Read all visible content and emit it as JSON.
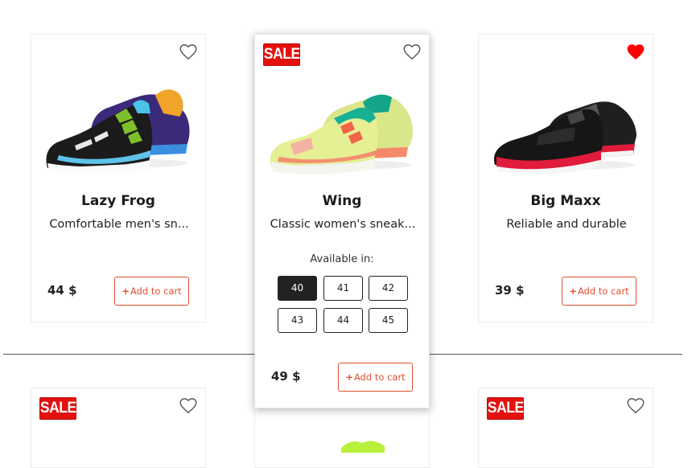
{
  "products": [
    {
      "name": "Lazy Frog",
      "description": "Comfortable men's sn...",
      "price": "44 $",
      "add_to_cart": "Add to cart",
      "favorite": false,
      "sale": false
    },
    {
      "name": "Wing",
      "description": "Classic women's sneak...",
      "price": "49 $",
      "add_to_cart": "Add to cart",
      "favorite": false,
      "sale": true,
      "sale_label": "SALE",
      "available_label": "Available in:",
      "sizes": [
        "40",
        "41",
        "42",
        "43",
        "44",
        "45"
      ],
      "selected_size": "40"
    },
    {
      "name": "Big Maxx",
      "description": "Reliable and durable",
      "price": "39 $",
      "add_to_cart": "Add to cart",
      "favorite": true,
      "sale": false
    }
  ],
  "second_row": [
    {
      "sale": true,
      "sale_label": "SALE",
      "favorite": false
    },
    {
      "sale": false,
      "favorite": false
    },
    {
      "sale": true,
      "sale_label": "SALE",
      "favorite": false
    }
  ],
  "colors": {
    "accent": "#e0502f",
    "sale_badge": "#e3120f",
    "favorite_active": "#ff0000",
    "selected_size_bg": "#222222"
  },
  "icons": {
    "favorite": "heart-icon",
    "cart_plus": "plus-icon"
  }
}
